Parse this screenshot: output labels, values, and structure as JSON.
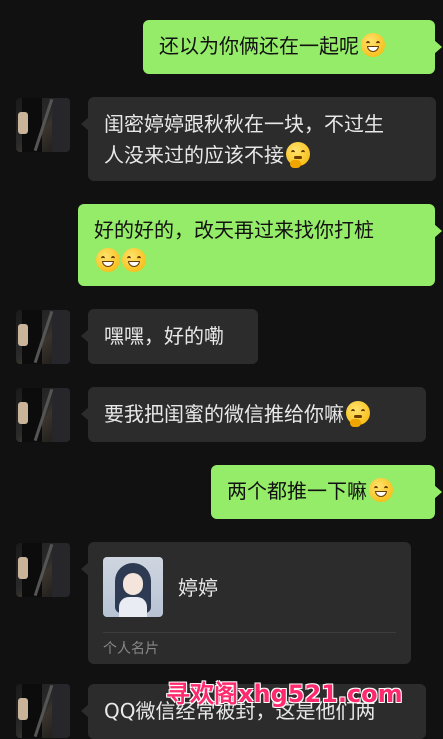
{
  "messages": [
    {
      "side": "me",
      "text": "还以为你俩还在一起呢",
      "emoji": "grin-sweat-icon"
    },
    {
      "side": "them",
      "text_line1": "闺密婷婷跟秋秋在一块，不过生",
      "text_line2": "人没来过的应该不接",
      "emoji": "thinking-icon"
    },
    {
      "side": "me",
      "text": "好的好的，改天再过来找你打桩",
      "emoji": "grin-icon"
    },
    {
      "side": "them",
      "text": "嘿嘿，好的嘞"
    },
    {
      "side": "them",
      "text": "要我把闺蜜的微信推给你嘛",
      "emoji": "thinking-icon"
    },
    {
      "side": "me",
      "text": "两个都推一下嘛",
      "emoji": "grin-icon"
    },
    {
      "side": "them",
      "type": "contact-card",
      "name": "婷婷",
      "card_type": "个人名片"
    },
    {
      "side": "them",
      "text": "QQ微信经常被封，这是他们两"
    }
  ],
  "watermark": "寻欢阁xhg521.com",
  "colors": {
    "background": "#111111",
    "my_bubble": "#95ec69",
    "their_bubble": "#2c2c2c",
    "watermark": "#ff2a6e"
  }
}
